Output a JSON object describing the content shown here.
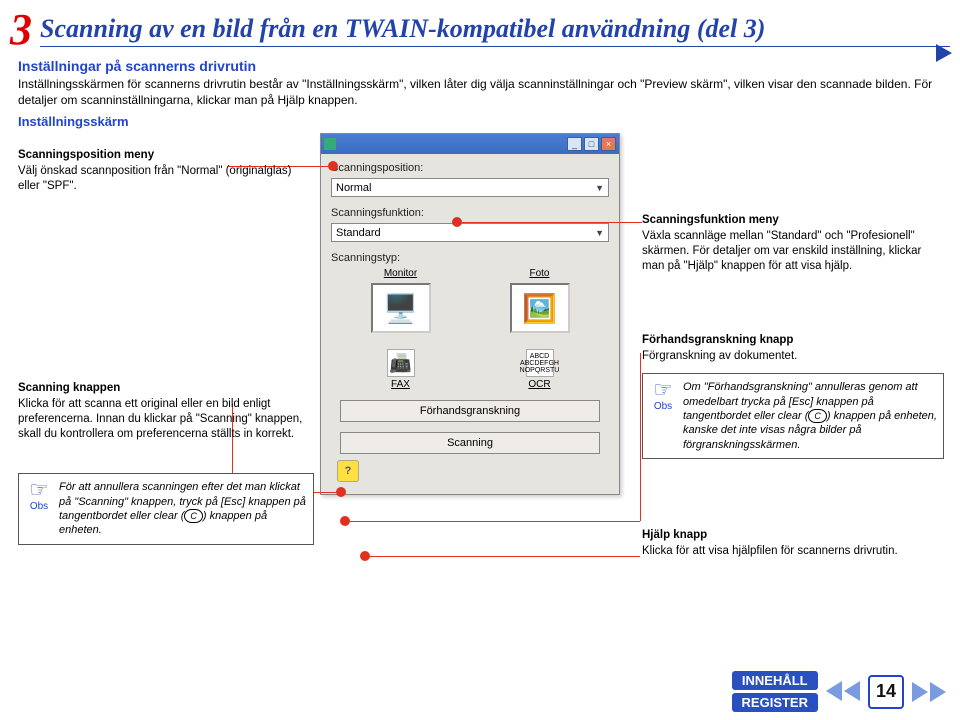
{
  "step_number": "3",
  "title": "Scanning av en bild från en TWAIN-kompatibel användning (del 3)",
  "subtitle": "Inställningar på scannerns drivrutin",
  "intro": "Inställningsskärmen för scannerns drivrutin består av \"Inställningsskärm\", vilken låter dig välja scanninställningar och \"Preview skärm\", vilken visar den scannade bilden. För detaljer om scanninställningarna, klickar man på Hjälp knappen.",
  "section_label": "Inställningsskärm",
  "dialog": {
    "scan_position_label": "Scanningsposition:",
    "scan_position_value": "Normal",
    "scan_function_label": "Scanningsfunktion:",
    "scan_function_value": "Standard",
    "scan_type_label": "Scanningstyp:",
    "type_monitor": "Monitor",
    "type_foto": "Foto",
    "fax_label": "FAX",
    "ocr_label": "OCR",
    "preview_btn": "Förhandsgranskning",
    "scan_btn": "Scanning"
  },
  "anno": {
    "scanpos_h": "Scanningsposition meny",
    "scanpos_p": "Välj önskad scannposition från \"Normal\" (originalglas) eller \"SPF\".",
    "scanfunc_h": "Scanningsfunktion meny",
    "scanfunc_p": "Växla scannläge mellan \"Standard\" och \"Profesionell\" skärmen. För detaljer om var enskild inställning, klickar man på \"Hjälp\" knappen för att visa hjälp.",
    "preview_h": "Förhandsgranskning knapp",
    "preview_p": "Förgranskning av dokumentet.",
    "scanbtn_h": "Scanning knappen",
    "scanbtn_p": "Klicka för att scanna ett original eller en bild enligt preferencerna. Innan du klickar på \"Scanning\" knappen, skall du kontrollera om preferencerna ställts in korrekt.",
    "help_h": "Hjälp knapp",
    "help_p": "Klicka för att visa hjälpfilen för scannerns drivrutin."
  },
  "notes": {
    "obs_label": "Obs",
    "note1": "För att annullera scanningen efter det man klickat på \"Scanning\" knappen, tryck på [Esc] knappen på tangentbordet eller clear (",
    "note1b": ") knappen på enheten.",
    "clear_c": "C",
    "note2a": "Om \"Förhandsgranskning\" annulleras genom att omedelbart trycka på [Esc] knappen på tangentbordet eller clear (",
    "note2b": ") knappen på enheten, kanske det inte visas några bilder på förgranskningsskärmen."
  },
  "footer": {
    "contents": "INNEHÅLL",
    "register": "REGISTER",
    "page": "14"
  }
}
